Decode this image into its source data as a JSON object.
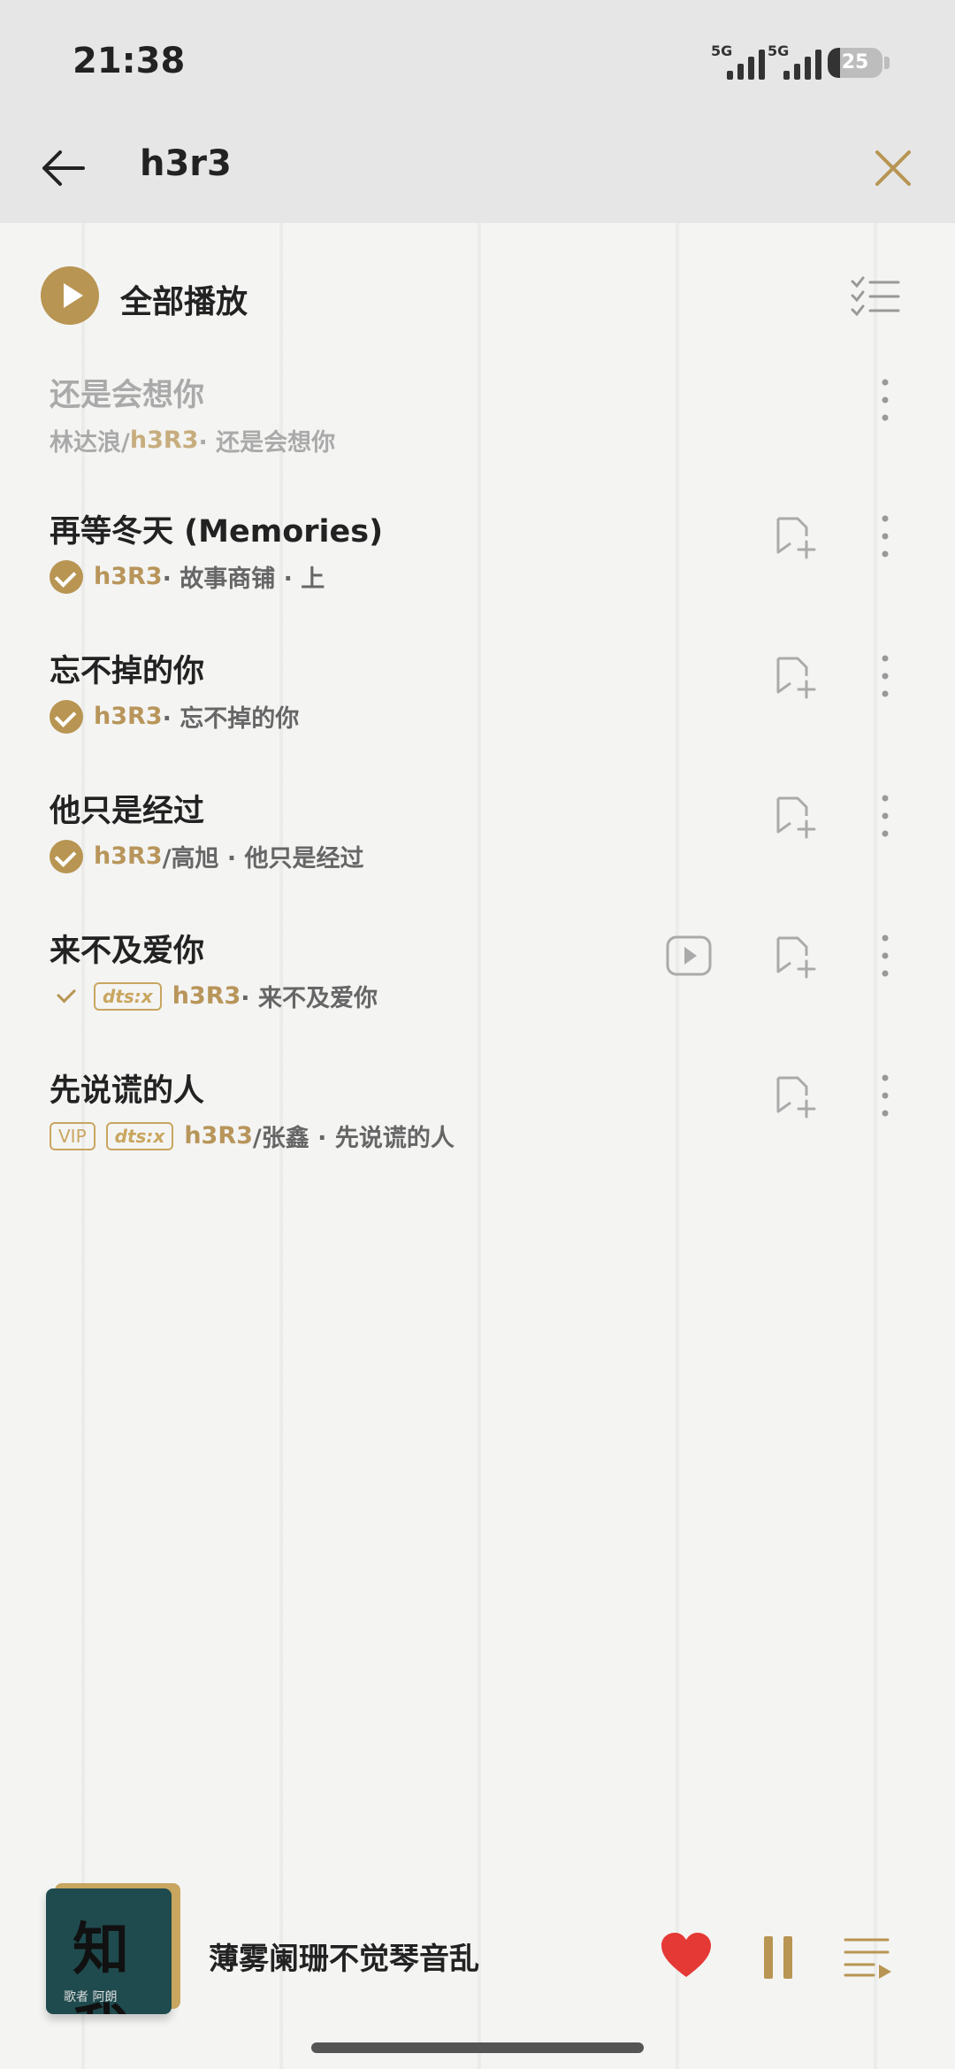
{
  "status": {
    "time": "21:38",
    "network1": "5G",
    "network2": "5G",
    "battery": "25"
  },
  "header": {
    "query": "h3r3"
  },
  "play_all": {
    "label": "全部播放"
  },
  "songs": [
    {
      "title": "还是会想你",
      "artist": "林达浪/",
      "artist_hl": "h3R3",
      "rest": " · 还是会想你"
    },
    {
      "title": "再等冬天 (Memories)",
      "artist_hl": "h3R3",
      "rest": " · 故事商铺 · 上"
    },
    {
      "title": "忘不掉的你",
      "artist_hl": "h3R3",
      "rest": " · 忘不掉的你"
    },
    {
      "title": "他只是经过",
      "artist_hl": "h3R3",
      "rest2": "/高旭 · 他只是经过"
    },
    {
      "title": "来不及爱你",
      "tag": "dts:x",
      "artist_hl": "h3R3",
      "rest": " · 来不及爱你"
    },
    {
      "title": "先说谎的人",
      "vip": "VIP",
      "tag": "dts:x",
      "artist_hl": "h3R3",
      "rest2": "/张鑫 · 先说谎的人"
    }
  ],
  "now_playing": {
    "title": "薄雾阑珊不觉琴音乱",
    "cover_text": "知我",
    "cover_caption": "歌者 阿朗"
  },
  "colors": {
    "accent": "#b89552",
    "heart": "#e53935"
  }
}
